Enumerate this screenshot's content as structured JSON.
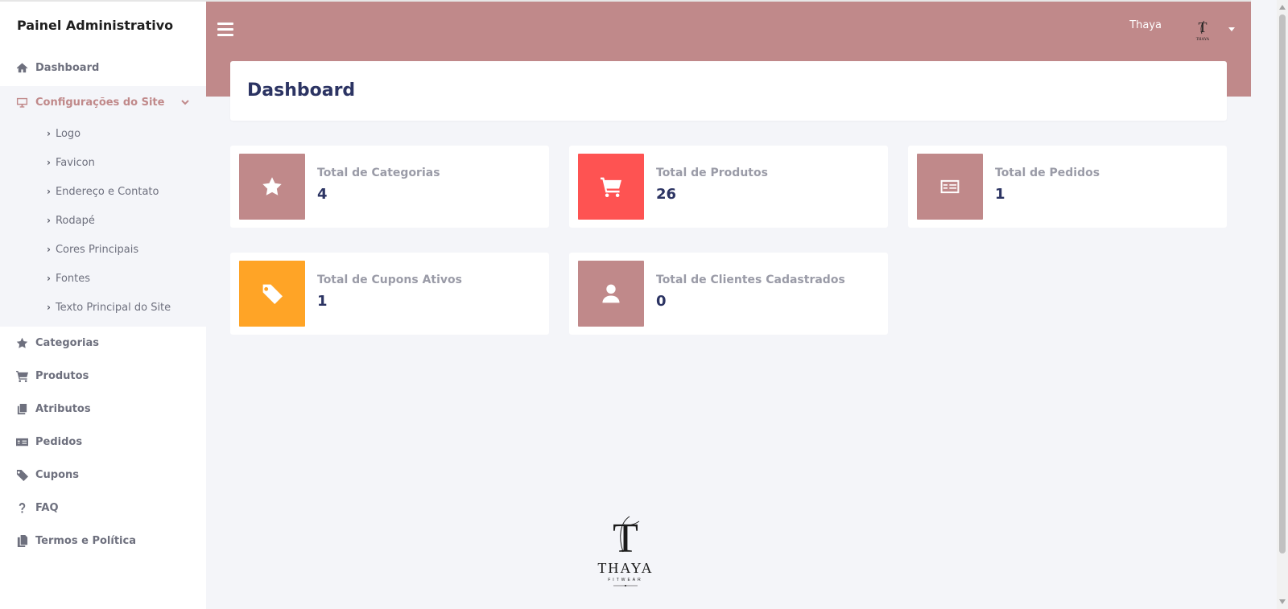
{
  "sidebar": {
    "brand": "Painel Administrativo",
    "items_top": [
      {
        "label": "Dashboard",
        "icon": "home-icon"
      }
    ],
    "group": {
      "label": "Configurações do Site",
      "icon": "monitor-icon",
      "subitems": [
        "Logo",
        "Favicon",
        "Endereço e Contato",
        "Rodapé",
        "Cores Principais",
        "Fontes",
        "Texto Principal do Site"
      ]
    },
    "items_bottom": [
      {
        "label": "Categorias",
        "icon": "star-icon"
      },
      {
        "label": "Produtos",
        "icon": "cart-icon"
      },
      {
        "label": "Atributos",
        "icon": "copy-icon"
      },
      {
        "label": "Pedidos",
        "icon": "money-check-icon"
      },
      {
        "label": "Cupons",
        "icon": "tag-icon"
      },
      {
        "label": "FAQ",
        "icon": "question-icon"
      },
      {
        "label": "Termos e Política",
        "icon": "files-icon"
      }
    ]
  },
  "topbar": {
    "user_name": "Thaya"
  },
  "header": {
    "title": "Dashboard"
  },
  "stats": [
    {
      "label": "Total de Categorias",
      "value": "4",
      "icon": "star-icon",
      "color": "#c0898a"
    },
    {
      "label": "Total de Produtos",
      "value": "26",
      "icon": "cart-icon",
      "color": "#fe5352"
    },
    {
      "label": "Total de Pedidos",
      "value": "1",
      "icon": "money-check-icon",
      "color": "#c0898a"
    },
    {
      "label": "Total de Cupons Ativos",
      "value": "1",
      "icon": "tag-icon",
      "color": "#ffa426"
    },
    {
      "label": "Total de Clientes Cadastrados",
      "value": "0",
      "icon": "user-icon",
      "color": "#c0898a"
    }
  ],
  "footer_logo": {
    "name": "THAYA",
    "tagline": "FITWEAR"
  },
  "colors": {
    "accent": "#c0898a",
    "title": "#2c3463",
    "background": "#f4f5f9"
  }
}
